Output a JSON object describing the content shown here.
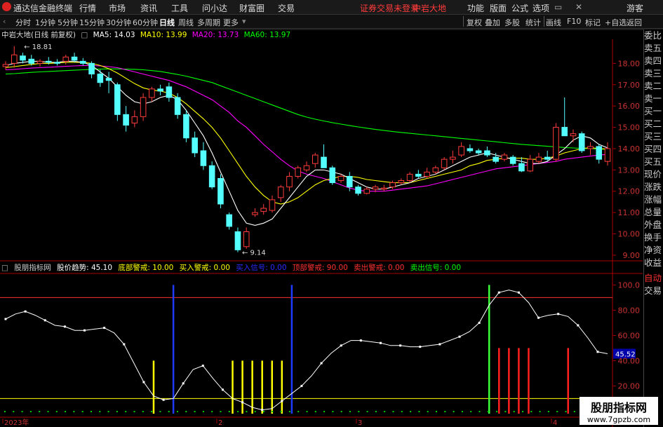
{
  "app": {
    "title": "通达信金融终端",
    "menu": [
      "行情",
      "市场",
      "资讯",
      "工具",
      "问小达",
      "财富圈",
      "交易"
    ],
    "notice": "证券交易未登录",
    "stock_name": "中岩大地",
    "right_menu": [
      "功能",
      "版面",
      "公式",
      "选项"
    ],
    "guest": "游客"
  },
  "toolbar": {
    "periods": [
      "分时",
      "1分钟",
      "5分钟",
      "15分钟",
      "30分钟",
      "60分钟",
      "日线",
      "周线",
      "多周期",
      "更多"
    ],
    "active_period": "日线",
    "actions": [
      "复权",
      "叠加",
      "多股",
      "统计",
      "画线",
      "F10",
      "标记",
      "+自选",
      "返回"
    ]
  },
  "price_info": {
    "title": "中岩大地(日线 前复权)",
    "ma5": "MA5: 14.03",
    "ma10": "MA10: 13.99",
    "ma20": "MA20: 13.73",
    "ma60": "MA60: 13.97",
    "high_label": "18.81",
    "low_label": "9.14",
    "colors": {
      "ma5": "#ffffff",
      "ma10": "#ffff00",
      "ma20": "#ff00ff",
      "ma60": "#00ff00"
    }
  },
  "right_panel": {
    "items": [
      "委比",
      "卖五",
      "卖四",
      "卖三",
      "卖二",
      "卖一",
      "买一",
      "买二",
      "买三",
      "买四",
      "买五",
      "现价",
      "涨跌",
      "涨幅",
      "总量",
      "外盘",
      "换手",
      "净资",
      "收益"
    ],
    "lower_items": [
      "自动",
      "交易"
    ]
  },
  "indicator": {
    "name": "股朋指标网",
    "trend": "股价趋势: 45.10",
    "bottom_warn": "底部警戒: 10.00",
    "buy_warn": "买入警戒: 0.00",
    "buy_signal": "买入信号: 0.00",
    "top_warn": "顶部警戒: 90.00",
    "sell_warn": "卖出警戒: 0.00",
    "sell_signal": "卖出信号: 0.00",
    "current_value": "45.52"
  },
  "axes": {
    "price_ticks": [
      "18.00",
      "17.00",
      "16.00",
      "15.00",
      "14.00",
      "13.00",
      "12.00",
      "11.00",
      "10.00",
      "9.00"
    ],
    "indicator_ticks": [
      "100.0",
      "80.00",
      "60.00",
      "40.00",
      "20.00"
    ],
    "x_labels": [
      "2023年",
      "2",
      "3",
      "4"
    ]
  },
  "watermark": {
    "line1": "股朋指标网",
    "line2": "www.7gpzb.com"
  },
  "chart_data": {
    "type": "candlestick",
    "candles": [
      {
        "o": 17.85,
        "h": 18.1,
        "l": 17.7,
        "c": 17.95
      },
      {
        "o": 18.0,
        "h": 18.81,
        "l": 17.8,
        "c": 18.4
      },
      {
        "o": 18.35,
        "h": 18.5,
        "l": 18.0,
        "c": 18.15
      },
      {
        "o": 18.2,
        "h": 18.4,
        "l": 17.9,
        "c": 18.0
      },
      {
        "o": 18.0,
        "h": 18.2,
        "l": 17.85,
        "c": 18.1
      },
      {
        "o": 18.1,
        "h": 18.3,
        "l": 17.95,
        "c": 18.05
      },
      {
        "o": 18.05,
        "h": 18.2,
        "l": 17.9,
        "c": 18.0
      },
      {
        "o": 18.1,
        "h": 18.4,
        "l": 17.95,
        "c": 18.3
      },
      {
        "o": 18.3,
        "h": 18.5,
        "l": 18.05,
        "c": 18.15
      },
      {
        "o": 18.1,
        "h": 18.25,
        "l": 17.9,
        "c": 18.0
      },
      {
        "o": 18.0,
        "h": 18.1,
        "l": 17.3,
        "c": 17.5
      },
      {
        "o": 17.5,
        "h": 17.7,
        "l": 16.9,
        "c": 17.1
      },
      {
        "o": 17.3,
        "h": 17.6,
        "l": 16.6,
        "c": 17.2
      },
      {
        "o": 17.0,
        "h": 17.1,
        "l": 15.3,
        "c": 15.6
      },
      {
        "o": 15.6,
        "h": 16.0,
        "l": 14.8,
        "c": 15.1
      },
      {
        "o": 15.2,
        "h": 15.8,
        "l": 15.0,
        "c": 15.5
      },
      {
        "o": 15.5,
        "h": 16.6,
        "l": 15.3,
        "c": 16.4
      },
      {
        "o": 16.4,
        "h": 16.9,
        "l": 16.2,
        "c": 16.8
      },
      {
        "o": 16.8,
        "h": 17.0,
        "l": 16.5,
        "c": 16.7
      },
      {
        "o": 16.9,
        "h": 17.1,
        "l": 16.2,
        "c": 16.4
      },
      {
        "o": 16.4,
        "h": 16.6,
        "l": 15.4,
        "c": 15.6
      },
      {
        "o": 15.6,
        "h": 15.8,
        "l": 14.3,
        "c": 14.5
      },
      {
        "o": 14.5,
        "h": 14.8,
        "l": 13.6,
        "c": 13.8
      },
      {
        "o": 13.9,
        "h": 14.3,
        "l": 13.0,
        "c": 13.2
      },
      {
        "o": 13.2,
        "h": 13.4,
        "l": 12.1,
        "c": 12.2
      },
      {
        "o": 12.6,
        "h": 12.8,
        "l": 11.2,
        "c": 11.4
      },
      {
        "o": 10.9,
        "h": 11.0,
        "l": 10.2,
        "c": 10.35
      },
      {
        "o": 10.1,
        "h": 10.3,
        "l": 9.14,
        "c": 9.25
      },
      {
        "o": 9.4,
        "h": 10.3,
        "l": 9.3,
        "c": 10.1
      },
      {
        "o": 10.9,
        "h": 11.2,
        "l": 10.8,
        "c": 11.0
      },
      {
        "o": 11.05,
        "h": 11.4,
        "l": 10.9,
        "c": 11.2
      },
      {
        "o": 11.1,
        "h": 11.8,
        "l": 11.0,
        "c": 11.6
      },
      {
        "o": 11.7,
        "h": 12.3,
        "l": 11.5,
        "c": 12.2
      },
      {
        "o": 12.2,
        "h": 12.9,
        "l": 12.0,
        "c": 12.7
      },
      {
        "o": 12.7,
        "h": 13.2,
        "l": 12.6,
        "c": 13.1
      },
      {
        "o": 13.0,
        "h": 13.4,
        "l": 12.9,
        "c": 13.2
      },
      {
        "o": 13.3,
        "h": 13.8,
        "l": 13.1,
        "c": 13.7
      },
      {
        "o": 13.6,
        "h": 14.2,
        "l": 13.5,
        "c": 13.1
      },
      {
        "o": 13.1,
        "h": 13.2,
        "l": 12.3,
        "c": 12.4
      },
      {
        "o": 12.5,
        "h": 12.8,
        "l": 12.4,
        "c": 12.7
      },
      {
        "o": 12.7,
        "h": 12.9,
        "l": 12.0,
        "c": 12.2
      },
      {
        "o": 12.2,
        "h": 12.3,
        "l": 11.8,
        "c": 11.9
      },
      {
        "o": 11.9,
        "h": 12.2,
        "l": 11.85,
        "c": 12.1
      },
      {
        "o": 12.1,
        "h": 12.3,
        "l": 11.95,
        "c": 12.2
      },
      {
        "o": 12.1,
        "h": 12.3,
        "l": 12.0,
        "c": 12.15
      },
      {
        "o": 12.2,
        "h": 12.5,
        "l": 12.1,
        "c": 12.4
      },
      {
        "o": 12.4,
        "h": 12.6,
        "l": 12.3,
        "c": 12.5
      },
      {
        "o": 12.5,
        "h": 12.9,
        "l": 12.4,
        "c": 12.8
      },
      {
        "o": 12.8,
        "h": 13.0,
        "l": 12.6,
        "c": 12.7
      },
      {
        "o": 12.7,
        "h": 13.1,
        "l": 12.6,
        "c": 12.9
      },
      {
        "o": 12.9,
        "h": 13.2,
        "l": 12.8,
        "c": 13.1
      },
      {
        "o": 13.1,
        "h": 13.6,
        "l": 13.0,
        "c": 13.5
      },
      {
        "o": 13.5,
        "h": 13.9,
        "l": 13.3,
        "c": 13.6
      },
      {
        "o": 13.7,
        "h": 14.3,
        "l": 13.6,
        "c": 14.1
      },
      {
        "o": 14.0,
        "h": 14.2,
        "l": 13.8,
        "c": 13.9
      },
      {
        "o": 13.9,
        "h": 14.0,
        "l": 13.7,
        "c": 13.8
      },
      {
        "o": 13.9,
        "h": 14.1,
        "l": 13.6,
        "c": 13.7
      },
      {
        "o": 13.6,
        "h": 13.8,
        "l": 13.3,
        "c": 13.4
      },
      {
        "o": 13.5,
        "h": 13.8,
        "l": 13.4,
        "c": 13.7
      },
      {
        "o": 13.6,
        "h": 13.7,
        "l": 13.2,
        "c": 13.3
      },
      {
        "o": 13.3,
        "h": 13.6,
        "l": 12.9,
        "c": 12.95
      },
      {
        "o": 12.95,
        "h": 13.7,
        "l": 12.9,
        "c": 13.5
      },
      {
        "o": 13.4,
        "h": 13.8,
        "l": 13.3,
        "c": 13.6
      },
      {
        "o": 13.6,
        "h": 13.9,
        "l": 13.4,
        "c": 13.5
      },
      {
        "o": 13.5,
        "h": 15.2,
        "l": 13.4,
        "c": 15.0
      },
      {
        "o": 15.0,
        "h": 16.4,
        "l": 14.8,
        "c": 14.6
      },
      {
        "o": 14.6,
        "h": 14.9,
        "l": 14.3,
        "c": 14.7
      },
      {
        "o": 14.7,
        "h": 14.8,
        "l": 13.8,
        "c": 13.9
      },
      {
        "o": 14.0,
        "h": 14.3,
        "l": 13.7,
        "c": 14.1
      },
      {
        "o": 14.1,
        "h": 14.2,
        "l": 13.3,
        "c": 13.5
      },
      {
        "o": 13.4,
        "h": 14.3,
        "l": 13.2,
        "c": 14.0
      }
    ],
    "ma5": [
      17.9,
      18.0,
      18.05,
      18.1,
      18.1,
      18.05,
      18.05,
      18.1,
      18.1,
      18.05,
      17.9,
      17.6,
      17.3,
      16.9,
      16.5,
      16.2,
      16.1,
      16.2,
      16.4,
      16.5,
      16.3,
      15.8,
      15.2,
      14.6,
      13.8,
      12.9,
      12.0,
      11.1,
      10.5,
      10.4,
      10.5,
      10.7,
      11.2,
      11.7,
      12.2,
      12.7,
      13.0,
      13.0,
      12.9,
      12.8,
      12.6,
      12.4,
      12.2,
      12.1,
      12.1,
      12.2,
      12.3,
      12.4,
      12.6,
      12.7,
      12.8,
      13.0,
      13.2,
      13.4,
      13.6,
      13.7,
      13.8,
      13.7,
      13.6,
      13.5,
      13.4,
      13.3,
      13.3,
      13.4,
      13.7,
      14.0,
      14.4,
      14.6,
      14.5,
      14.2,
      14.03
    ],
    "ma10": [
      17.8,
      17.85,
      17.9,
      17.95,
      18.0,
      18.0,
      18.02,
      18.05,
      18.05,
      18.05,
      18.0,
      17.9,
      17.75,
      17.55,
      17.3,
      17.05,
      16.85,
      16.75,
      16.7,
      16.6,
      16.4,
      16.1,
      15.75,
      15.4,
      15.0,
      14.5,
      13.9,
      13.3,
      12.7,
      12.2,
      11.8,
      11.5,
      11.4,
      11.5,
      11.7,
      12.0,
      12.3,
      12.5,
      12.6,
      12.7,
      12.7,
      12.65,
      12.55,
      12.5,
      12.45,
      12.4,
      12.4,
      12.4,
      12.5,
      12.6,
      12.7,
      12.8,
      12.9,
      13.0,
      13.2,
      13.3,
      13.45,
      13.5,
      13.55,
      13.55,
      13.55,
      13.5,
      13.5,
      13.55,
      13.65,
      13.8,
      13.9,
      14.0,
      14.05,
      14.0,
      13.99
    ],
    "ma20": [
      17.7,
      17.72,
      17.75,
      17.78,
      17.8,
      17.82,
      17.84,
      17.86,
      17.88,
      17.9,
      17.9,
      17.88,
      17.85,
      17.8,
      17.7,
      17.6,
      17.5,
      17.4,
      17.3,
      17.2,
      17.05,
      16.9,
      16.7,
      16.5,
      16.3,
      16.0,
      15.7,
      15.3,
      15.0,
      14.6,
      14.2,
      13.85,
      13.5,
      13.2,
      12.95,
      12.8,
      12.7,
      12.6,
      12.45,
      12.3,
      12.15,
      12.05,
      12.0,
      12.0,
      12.0,
      12.05,
      12.1,
      12.15,
      12.2,
      12.25,
      12.35,
      12.45,
      12.55,
      12.65,
      12.75,
      12.85,
      12.95,
      13.05,
      13.1,
      13.15,
      13.2,
      13.25,
      13.3,
      13.35,
      13.4,
      13.5,
      13.55,
      13.6,
      13.65,
      13.7,
      13.73
    ],
    "ma60": [
      17.5,
      17.52,
      17.55,
      17.58,
      17.6,
      17.62,
      17.64,
      17.66,
      17.68,
      17.7,
      17.72,
      17.73,
      17.74,
      17.74,
      17.73,
      17.72,
      17.7,
      17.66,
      17.62,
      17.55,
      17.48,
      17.4,
      17.3,
      17.2,
      17.1,
      16.95,
      16.8,
      16.65,
      16.5,
      16.35,
      16.2,
      16.05,
      15.9,
      15.75,
      15.6,
      15.48,
      15.38,
      15.3,
      15.22,
      15.15,
      15.08,
      15.02,
      14.96,
      14.9,
      14.85,
      14.8,
      14.76,
      14.72,
      14.68,
      14.64,
      14.6,
      14.56,
      14.52,
      14.48,
      14.44,
      14.4,
      14.36,
      14.32,
      14.28,
      14.24,
      14.2,
      14.17,
      14.14,
      14.11,
      14.08,
      14.05,
      14.03,
      14.01,
      14.0,
      13.98,
      13.97
    ],
    "indicator": [
      73,
      77,
      79,
      76,
      72,
      68,
      67,
      64,
      64,
      65,
      66,
      62,
      53,
      38,
      23,
      12,
      9,
      10,
      22,
      33,
      36,
      26,
      17,
      10,
      7,
      3,
      1,
      2,
      8,
      14,
      20,
      28,
      38,
      46,
      52,
      56,
      56,
      55,
      54,
      52,
      52,
      51,
      51,
      52,
      53,
      56,
      59,
      63,
      70,
      84,
      94,
      96,
      94,
      86,
      74,
      76,
      77,
      75,
      68,
      58,
      47,
      45.52
    ]
  }
}
